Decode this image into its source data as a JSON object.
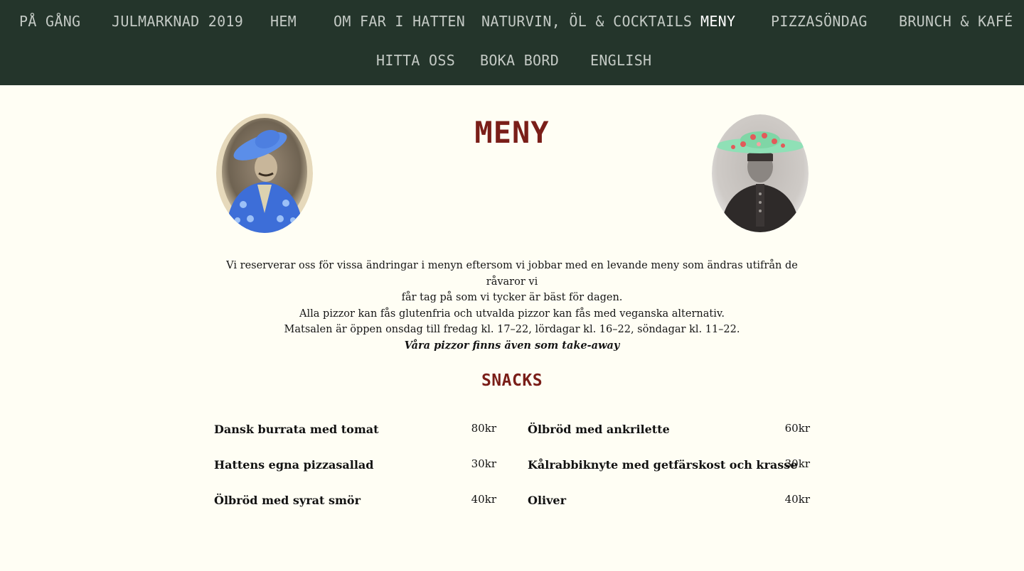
{
  "nav": {
    "items": [
      {
        "label": "PÅ GÅNG"
      },
      {
        "label": "JULMARKNAD 2019"
      },
      {
        "label": "HEM"
      },
      {
        "label": "OM FAR I HATTEN"
      },
      {
        "label": "NATURVIN, ÖL & COCKTAILS"
      },
      {
        "label": "MENY",
        "active": true
      },
      {
        "label": "PIZZASÖNDAG"
      },
      {
        "label": "BRUNCH & KAFÉ"
      },
      {
        "label": "HITTA OSS"
      },
      {
        "label": "BOKA BORD"
      },
      {
        "label": "ENGLISH"
      }
    ]
  },
  "header": {
    "title": "MENY"
  },
  "intro": {
    "lines": [
      "Vi reserverar oss för vissa ändringar i menyn eftersom vi jobbar med en levande meny som ändras utifrån de råvaror vi",
      "får tag på som vi tycker är bäst för dagen.",
      "Alla pizzor kan fås glutenfria och utvalda pizzor kan fås med veganska alternativ.",
      "Matsalen är öppen onsdag till fredag kl. 17–22, lördagar kl. 16–22, söndagar kl. 11–22."
    ],
    "emphasis": "Våra pizzor finns även som take-away"
  },
  "snacks": {
    "title": "SNACKS",
    "items": [
      {
        "name": "Dansk burrata med tomat",
        "price": "80kr"
      },
      {
        "name": "Ölbröd med ankrilette",
        "price": "60kr"
      },
      {
        "name": "Hattens egna pizzasallad",
        "price": "30kr"
      },
      {
        "name": "Kålrabbiknyte med getfärskost och krasse",
        "price": "30kr"
      },
      {
        "name": "Ölbröd med syrat smör",
        "price": "40kr"
      },
      {
        "name": "Oliver",
        "price": "40kr"
      }
    ]
  },
  "colors": {
    "nav_bg": "#24352b",
    "nav_text": "#c3c9c4",
    "nav_active": "#ffffff",
    "accent": "#7a1e18",
    "page_bg": "#fffef4"
  },
  "icons": {
    "left_portrait": "man-blue-hat-portrait",
    "right_portrait": "woman-flower-hat-portrait"
  }
}
